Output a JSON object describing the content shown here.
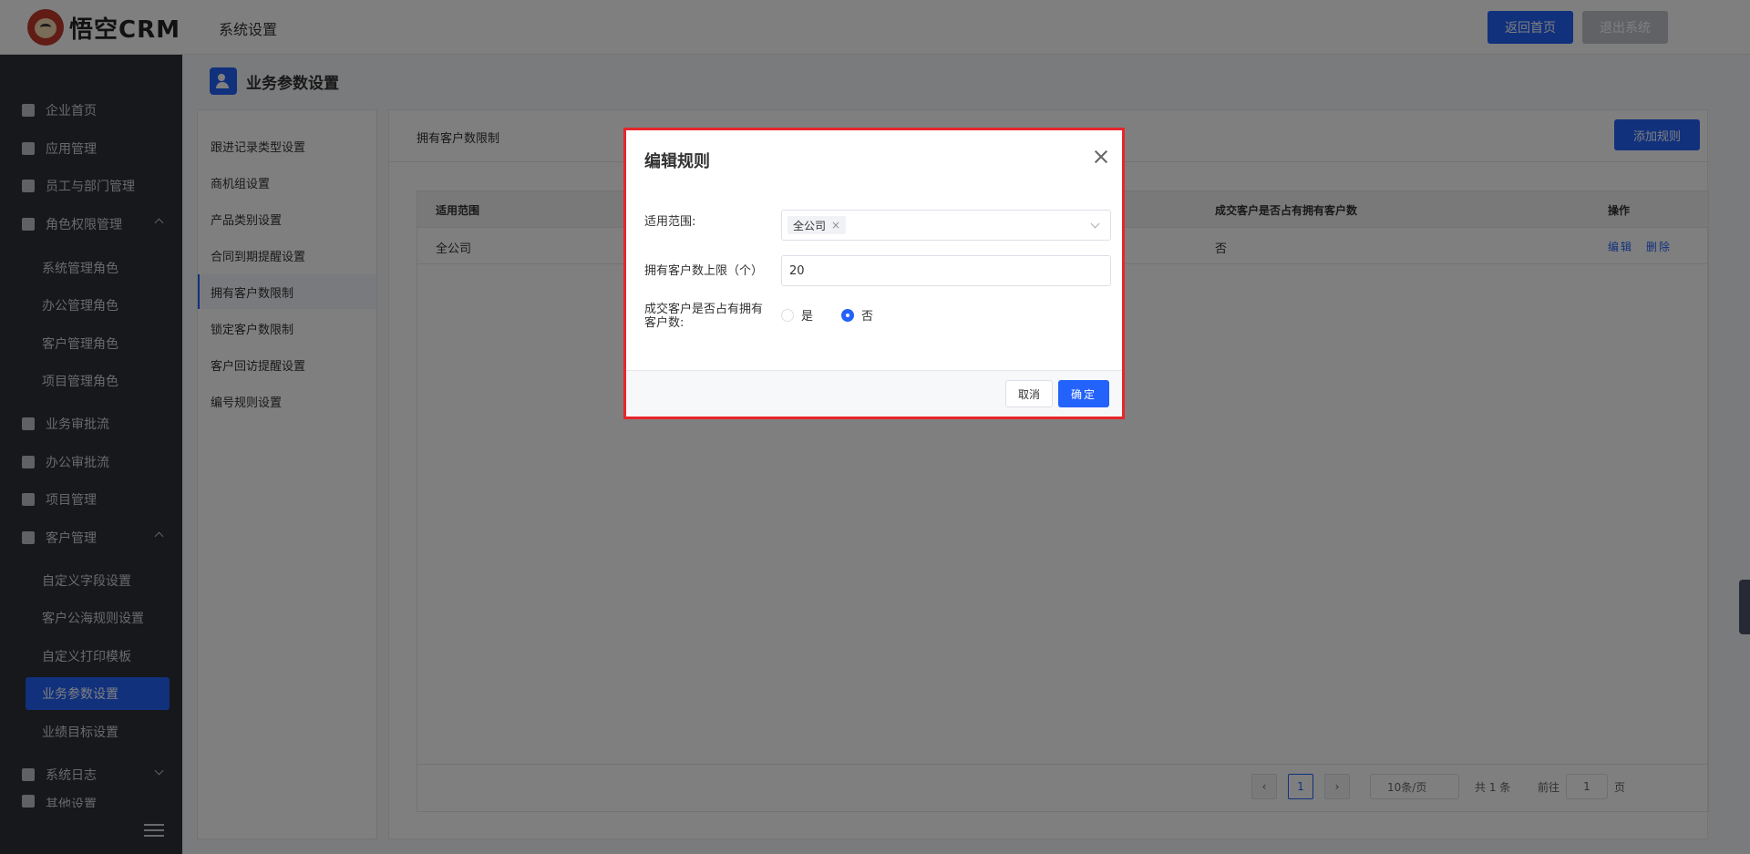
{
  "header": {
    "logo_text": "悟空CRM",
    "title": "系统设置",
    "home_button": "返回首页",
    "logout_button": "退出系统"
  },
  "sidebar": {
    "items": [
      {
        "label": "企业首页",
        "icon": "home-icon"
      },
      {
        "label": "应用管理",
        "icon": "grid-icon"
      },
      {
        "label": "员工与部门管理",
        "icon": "users-icon"
      },
      {
        "label": "角色权限管理",
        "icon": "user-icon",
        "expanded": true
      },
      {
        "label": "业务审批流",
        "icon": "user-icon"
      },
      {
        "label": "办公审批流",
        "icon": "user-icon"
      },
      {
        "label": "项目管理",
        "icon": "list-icon"
      },
      {
        "label": "客户管理",
        "icon": "building-icon",
        "expanded": true
      },
      {
        "label": "系统日志",
        "icon": "clipboard-icon",
        "expanded": false
      },
      {
        "label": "其他设置",
        "icon": "gear-icon"
      }
    ],
    "role_subitems": [
      "系统管理角色",
      "办公管理角色",
      "客户管理角色",
      "项目管理角色"
    ],
    "customer_subitems": [
      "自定义字段设置",
      "客户公海规则设置",
      "自定义打印模板",
      "业务参数设置",
      "业绩目标设置"
    ],
    "active_subitem": "业务参数设置"
  },
  "page": {
    "title": "业务参数设置"
  },
  "settings_menu": {
    "items": [
      "跟进记录类型设置",
      "商机组设置",
      "产品类别设置",
      "合同到期提醒设置",
      "拥有客户数限制",
      "锁定客户数限制",
      "客户回访提醒设置",
      "编号规则设置"
    ],
    "active": "拥有客户数限制"
  },
  "main": {
    "title": "拥有客户数限制",
    "add_button": "添加规则",
    "table": {
      "headers": [
        "适用范围",
        "成交客户是否占有拥有客户数",
        "操作"
      ],
      "rows": [
        {
          "scope": "全公司",
          "counts": "否",
          "edit": "编辑",
          "delete": "删除"
        }
      ]
    },
    "pagination": {
      "current_page": "1",
      "page_size": "10条/页",
      "total": "共 1 条",
      "goto_label": "前往",
      "goto_value": "1",
      "page_unit": "页"
    }
  },
  "modal": {
    "title": "编辑规则",
    "scope_label": "适用范围:",
    "scope_tag": "全公司",
    "limit_label": "拥有客户数上限（个）",
    "limit_value": "20",
    "deal_label_line1": "成交客户是否占有拥有",
    "deal_label_line2": "客户数:",
    "radio_yes": "是",
    "radio_no": "否",
    "selected": "否",
    "cancel_button": "取消",
    "ok_button": "确定"
  },
  "colors": {
    "primary": "#2362fb",
    "sidebar_bg": "#2d3037",
    "highlight_border": "#e8262a"
  }
}
